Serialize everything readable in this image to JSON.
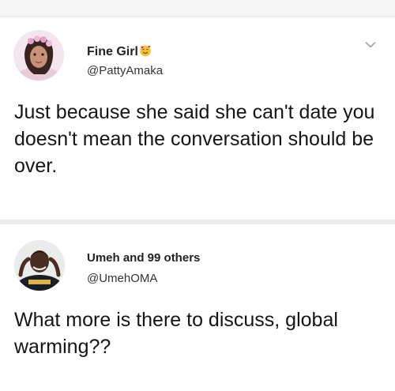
{
  "tweets": [
    {
      "display_name": "Fine Girl",
      "name_emoji": "smiling-face-with-hearts-emoji",
      "handle": "@PattyAmaka",
      "text": "Just because she said she can't date you doesn't mean the conversation should be over."
    },
    {
      "display_name": "Umeh and 99 others",
      "handle": "@UmehOMA",
      "text": "What more is there to discuss, global warming??"
    }
  ],
  "icons": {
    "menu": "chevron-down-icon"
  }
}
